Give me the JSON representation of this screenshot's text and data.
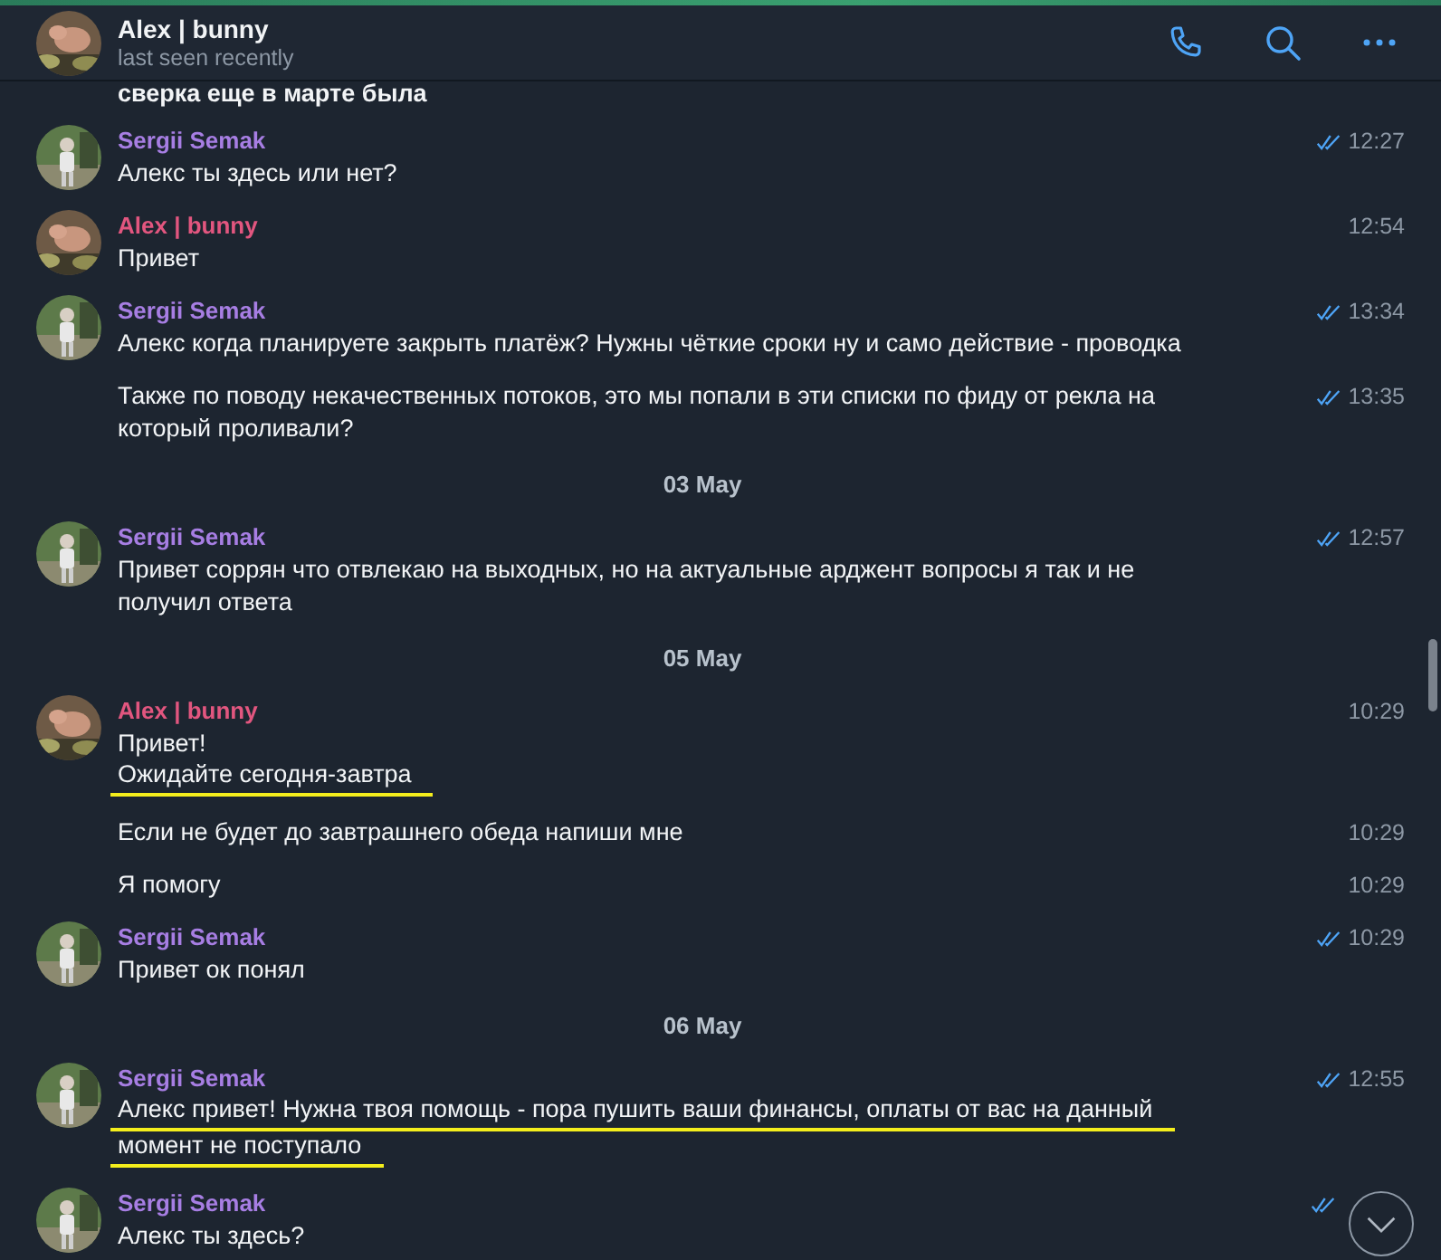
{
  "header": {
    "title": "Alex | bunny",
    "status": "last seen recently",
    "avatar": {
      "kind": "animal"
    }
  },
  "items": [
    {
      "kind": "fragment",
      "text": "сверка еще в марте была"
    },
    {
      "kind": "group",
      "sender": "Sergii Semak",
      "color": "#a77ee3",
      "avatar": {
        "kind": "figure"
      },
      "messages": [
        {
          "lines": [
            {
              "text": "Алекс ты здесь или нет?",
              "underlined": false
            }
          ],
          "time": "12:27",
          "read": true
        }
      ]
    },
    {
      "kind": "group",
      "sender": "Alex | bunny",
      "color": "#e2567f",
      "avatar": {
        "kind": "animal"
      },
      "messages": [
        {
          "lines": [
            {
              "text": "Привет",
              "underlined": false
            }
          ],
          "time": "12:54",
          "read": false
        }
      ]
    },
    {
      "kind": "group",
      "sender": "Sergii Semak",
      "color": "#a77ee3",
      "avatar": {
        "kind": "figure"
      },
      "messages": [
        {
          "lines": [
            {
              "text": "Алекс когда планируете закрыть платёж? Нужны чёткие сроки ну и само действие - проводка",
              "underlined": false
            }
          ],
          "time": "13:34",
          "read": true
        },
        {
          "lines": [
            {
              "text": "Также по поводу некачественных потоков, это мы попали в эти списки по фиду от рекла на",
              "underlined": false
            },
            {
              "text": "который проливали?",
              "underlined": false
            }
          ],
          "time": "13:35",
          "read": true
        }
      ]
    },
    {
      "kind": "date",
      "text": "03 May"
    },
    {
      "kind": "group",
      "sender": "Sergii Semak",
      "color": "#a77ee3",
      "avatar": {
        "kind": "figure"
      },
      "messages": [
        {
          "lines": [
            {
              "text": "Привет соррян что отвлекаю на выходных, но на актуальные арджент вопросы я так и не",
              "underlined": false
            },
            {
              "text": "получил ответа",
              "underlined": false
            }
          ],
          "time": "12:57",
          "read": true
        }
      ]
    },
    {
      "kind": "date",
      "text": "05 May"
    },
    {
      "kind": "group",
      "sender": "Alex | bunny",
      "color": "#e2567f",
      "avatar": {
        "kind": "animal"
      },
      "messages": [
        {
          "lines": [
            {
              "text": "Привет!",
              "underlined": false
            },
            {
              "text": "Ожидайте сегодня-завтра",
              "underlined": true
            }
          ],
          "time": "10:29",
          "read": false
        },
        {
          "lines": [
            {
              "text": "Если не будет до завтрашнего обеда напиши мне",
              "underlined": false
            }
          ],
          "time": "10:29",
          "read": false
        },
        {
          "lines": [
            {
              "text": "Я помогу",
              "underlined": false
            }
          ],
          "time": "10:29",
          "read": false
        }
      ]
    },
    {
      "kind": "group",
      "sender": "Sergii Semak",
      "color": "#a77ee3",
      "avatar": {
        "kind": "figure"
      },
      "messages": [
        {
          "lines": [
            {
              "text": "Привет ок понял",
              "underlined": false
            }
          ],
          "time": "10:29",
          "read": true
        }
      ]
    },
    {
      "kind": "date",
      "text": "06 May"
    },
    {
      "kind": "group",
      "sender": "Sergii Semak",
      "color": "#a77ee3",
      "avatar": {
        "kind": "figure"
      },
      "messages": [
        {
          "lines": [
            {
              "text": "Алекс привет! Нужна твоя помощь - пора пушить ваши финансы, оплаты от вас на данный",
              "underlined": true
            },
            {
              "text": "момент не поступало",
              "underlined": true
            }
          ],
          "time": "12:55",
          "read": true
        }
      ]
    },
    {
      "kind": "group",
      "sender": "Sergii Semak",
      "color": "#a77ee3",
      "avatar": {
        "kind": "figure"
      },
      "messages": [
        {
          "lines": [
            {
              "text": "Алекс ты здесь?",
              "underlined": false
            }
          ],
          "read": true
        }
      ]
    }
  ]
}
